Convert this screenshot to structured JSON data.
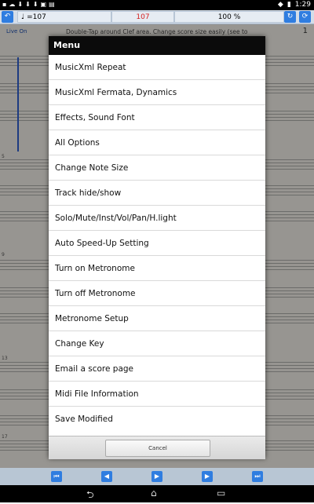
{
  "status_bar": {
    "left_icons": [
      "notification-icon",
      "cloud-icon",
      "download-icon",
      "download-icon",
      "download-icon",
      "image-icon",
      "briefcase-icon"
    ],
    "left_glyphs": "▪☁⬇⬇⬇▣▤",
    "time": "1:29",
    "wifi_glyph": "◆",
    "battery_glyph": "▮"
  },
  "toolbar": {
    "left_glyph": "↶",
    "tempo_note": "♩",
    "tempo": "=107",
    "tempo_value": "107",
    "zoom": "100 %",
    "right_glyph_1": "↻",
    "right_glyph_2": "⟳"
  },
  "score": {
    "live_label": "Live On",
    "hint_text": "Double-Tap around Clef area. Change score size easily (see to",
    "page_number": "1",
    "bar_numbers": [
      "5",
      "9",
      "13",
      "17"
    ]
  },
  "menu": {
    "title": "Menu",
    "items": [
      "MusicXml Repeat",
      "MusicXml Fermata, Dynamics",
      "Effects, Sound Font",
      "All Options",
      "Change Note Size",
      "Track hide/show",
      "Solo/Mute/Inst/Vol/Pan/H.light",
      "Auto Speed-Up Setting",
      "Turn on Metronome",
      "Turn off Metronome",
      "Metronome Setup",
      "Change Key",
      "Email a score page",
      "Midi File Information",
      "Save Modified"
    ],
    "cancel_label": "Cancel"
  },
  "playback": {
    "first_icon": "⏮",
    "prev_icon": "◀",
    "play_icon": "▶",
    "next_icon": "▶",
    "last_icon": "⏭"
  },
  "navbar": {
    "back_icon": "⮌",
    "home_icon": "⌂",
    "recents_icon": "▭"
  },
  "colors": {
    "accent": "#2f7de0",
    "tempo_red": "#d42020",
    "menu_title_bg": "#0b0b0b"
  }
}
